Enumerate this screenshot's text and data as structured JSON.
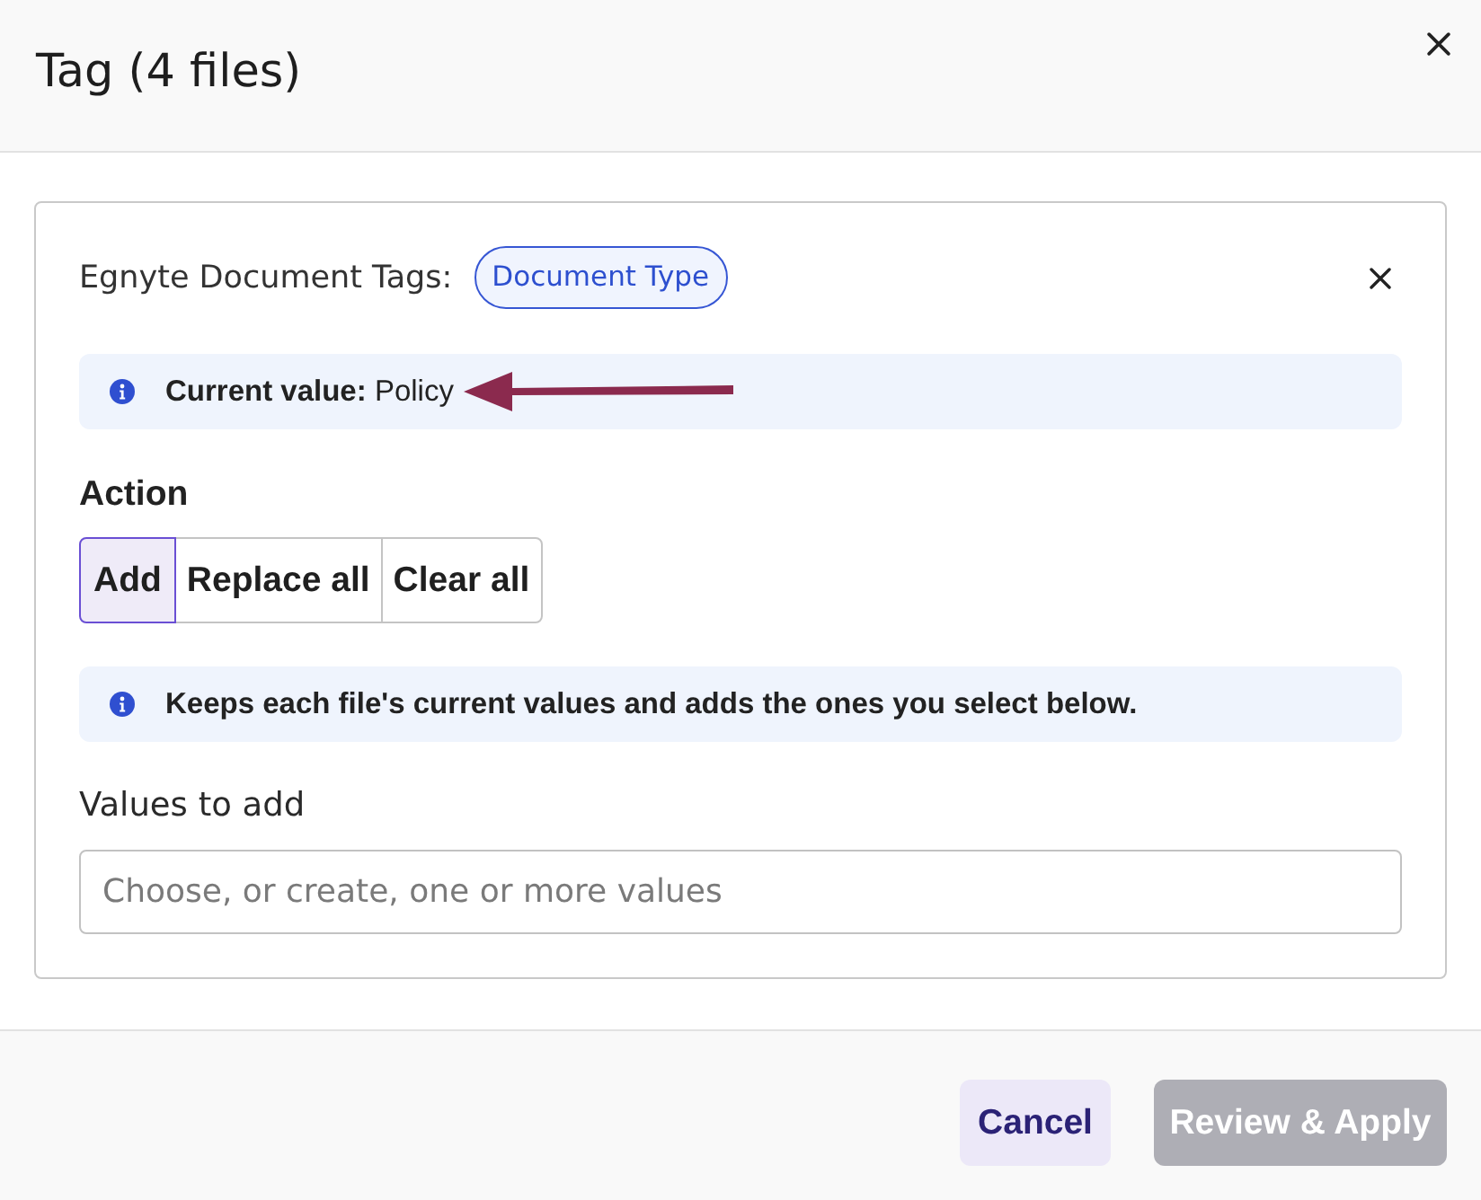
{
  "dialog": {
    "title": "Tag (4 files)"
  },
  "tag_row": {
    "label": "Egnyte Document Tags:",
    "chip": "Document Type"
  },
  "current_value": {
    "text": "**Current value:** Policy"
  },
  "annotations": [
    {
      "kind": "arrow"
    }
  ],
  "action": {
    "label": "Action",
    "options": [
      {
        "label": "Add",
        "selected": true
      },
      {
        "label": "Replace all",
        "selected": false
      },
      {
        "label": "Clear all",
        "selected": false
      }
    ]
  },
  "action_hint": {
    "text": "Keeps each file's current values and adds the ones you select below."
  },
  "values_field": {
    "label": "Values to add",
    "placeholder": "Choose, or create, one or more values"
  },
  "buttons": [
    {
      "label": "Cancel",
      "kind": "secondary",
      "disabled": false
    },
    {
      "label": "Review & Apply",
      "kind": "primary",
      "disabled": true
    }
  ]
}
